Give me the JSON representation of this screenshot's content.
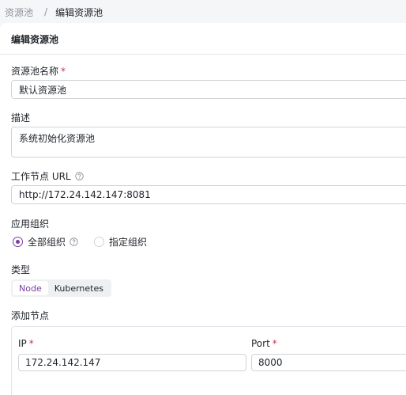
{
  "breadcrumb": {
    "parent": "资源池",
    "separator": "/",
    "current": "编辑资源池"
  },
  "panel": {
    "title": "编辑资源池"
  },
  "form": {
    "name_label": "资源池名称",
    "name_value": "默认资源池",
    "desc_label": "描述",
    "desc_value": "系统初始化资源池",
    "url_label": "工作节点 URL",
    "url_value": "http://172.24.142.147:8081",
    "org_label": "应用组织",
    "org_options": [
      "全部组织",
      "指定组织"
    ],
    "org_selected": "全部组织",
    "type_label": "类型",
    "type_options": [
      "Node",
      "Kubernetes"
    ],
    "type_selected": "Node",
    "nodes_label": "添加节点",
    "ip_label": "IP",
    "ip_value": "172.24.142.147",
    "port_label": "Port",
    "port_value": "8000",
    "required_mark": "*"
  },
  "colors": {
    "accent": "#7a3e9d",
    "required": "#d03050",
    "border": "#d0d3d6",
    "background": "#f5f6f7"
  },
  "icons": {
    "help": "question-circle-icon"
  }
}
